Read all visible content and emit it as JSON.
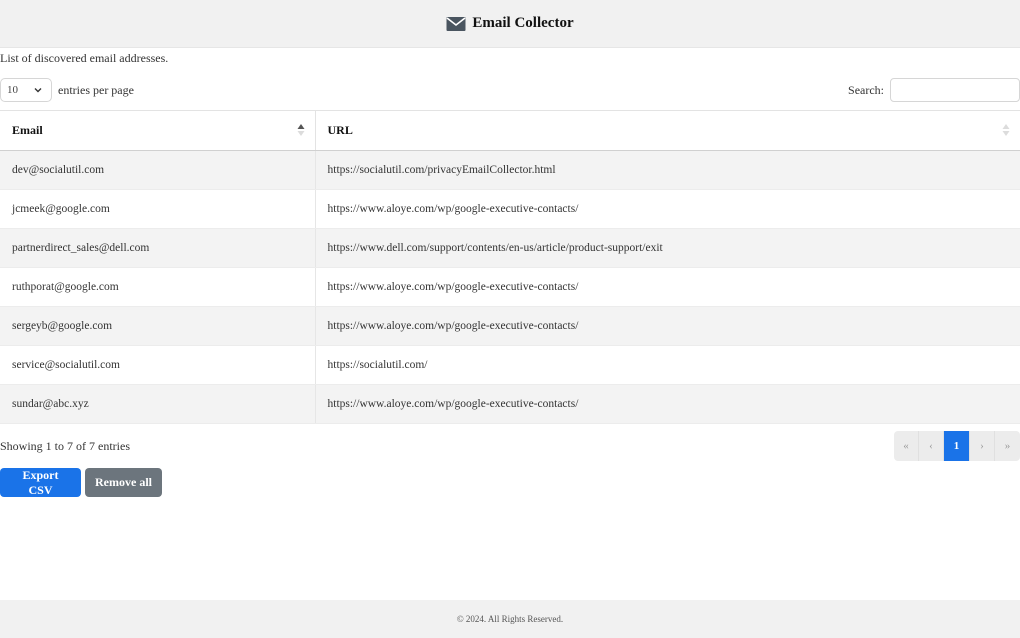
{
  "header": {
    "title": "Email Collector",
    "icon": "envelope-icon"
  },
  "subtitle": "List of discovered email addresses.",
  "controls": {
    "page_length_value": "10",
    "page_length_label": "entries per page",
    "search_label": "Search:",
    "search_value": ""
  },
  "table": {
    "columns": [
      "Email",
      "URL"
    ],
    "rows": [
      {
        "email": "dev@socialutil.com",
        "url": "https://socialutil.com/privacyEmailCollector.html"
      },
      {
        "email": "jcmeek@google.com",
        "url": "https://www.aloye.com/wp/google-executive-contacts/"
      },
      {
        "email": "partnerdirect_sales@dell.com",
        "url": "https://www.dell.com/support/contents/en-us/article/product-support/exit"
      },
      {
        "email": "ruthporat@google.com",
        "url": "https://www.aloye.com/wp/google-executive-contacts/"
      },
      {
        "email": "sergeyb@google.com",
        "url": "https://www.aloye.com/wp/google-executive-contacts/"
      },
      {
        "email": "service@socialutil.com",
        "url": "https://socialutil.com/"
      },
      {
        "email": "sundar@abc.xyz",
        "url": "https://www.aloye.com/wp/google-executive-contacts/"
      }
    ]
  },
  "info": "Showing 1 to 7 of 7 entries",
  "pager": {
    "first": "«",
    "prev": "‹",
    "current": "1",
    "next": "›",
    "last": "»"
  },
  "actions": {
    "export_label": "Export CSV",
    "remove_label": "Remove all"
  },
  "footer": "© 2024. All Rights Reserved.",
  "colors": {
    "primary": "#1a73e8",
    "secondary": "#6c757d",
    "stripe": "#f3f3f3"
  }
}
